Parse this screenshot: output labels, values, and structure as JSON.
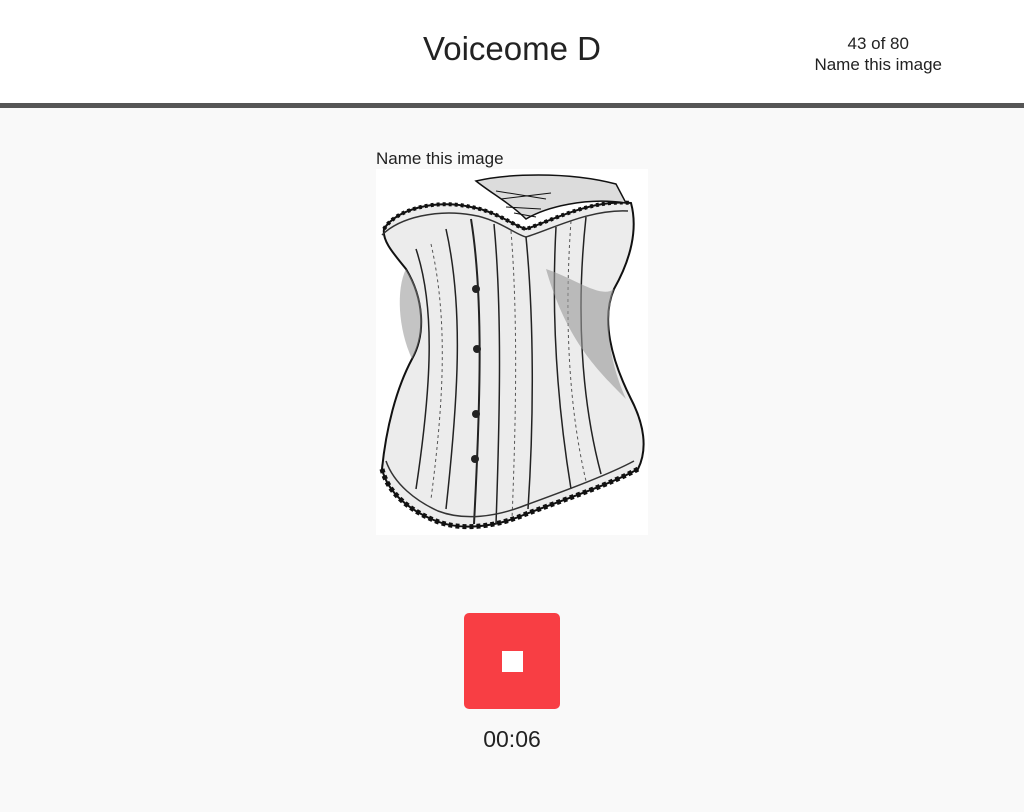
{
  "header": {
    "title": "Voiceome D",
    "progress": "43 of 80",
    "task_name": "Name this image"
  },
  "task": {
    "prompt": "Name this image",
    "image_subject": "corset"
  },
  "recorder": {
    "state": "recording",
    "button_icon": "stop-icon",
    "elapsed": "00:06",
    "button_color": "#f83e44"
  }
}
